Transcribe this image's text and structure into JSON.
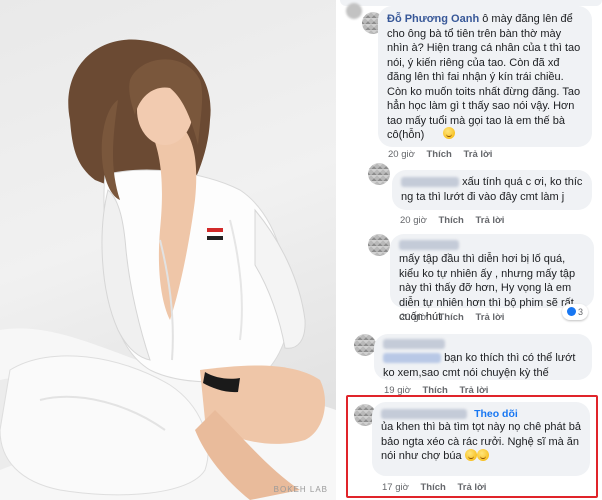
{
  "photo": {
    "watermark": "BOKEH LAB"
  },
  "comments": [
    {
      "author": "Đỗ Phương Oanh",
      "text": "ô mày đăng lên để cho ông bà tổ tiên trên bàn thờ mày nhìn à? Hiện trang cá nhân của t thì tao nói, ý kiến riêng của tao. Còn đã xđ đăng lên thì fai nhận ý kín trái chiều. Còn ko muốn toits nhất đừng đăng. Tao hẳn học làm gì t thấy sao nói vậy. Hơn tao mấy tuổi mà gọi tao là em thế bà cô(hỗn)",
      "time": "20 giờ",
      "like": "Thích",
      "reply": "Trả lời"
    },
    {
      "text": "xấu tính quá c ơi, ko thíc ng ta thì lướt đi vào đây cmt làm j",
      "time": "20 giờ",
      "like": "Thích",
      "reply": "Trả lời"
    },
    {
      "text": "mấy tập đầu thì diễn hơi bị lố quá, kiểu ko tự nhiên ấy , nhưng mấy tập này thì thấy đỡ hơn, Hy vọng là em diễn tự nhiên hơn thì bộ phim sẽ rất cuốn hút",
      "time": "20 giờ",
      "like": "Thích",
      "reply": "Trả lời",
      "reaction_count": "3"
    },
    {
      "text": "bạn ko thích thì có thể lướt ko xem,sao cmt nói chuyện kỳ thế",
      "time": "19 giờ",
      "like": "Thích",
      "reply": "Trả lời"
    },
    {
      "follow": "Theo dõi",
      "text": "ủa khen thì bà tìm tọt này nọ chê phát bả bảo ngta xéo cà rác rưởi. Nghệ sĩ mà ăn nói như chợ búa",
      "time": "17 giờ",
      "like": "Thích",
      "reply": "Trả lời"
    }
  ],
  "colors": {
    "bubble": "#f0f2f5",
    "author_blue": "#385898",
    "follow_blue": "#1877f2",
    "highlight_red": "#e0242a",
    "meta_gray": "#65676b"
  }
}
